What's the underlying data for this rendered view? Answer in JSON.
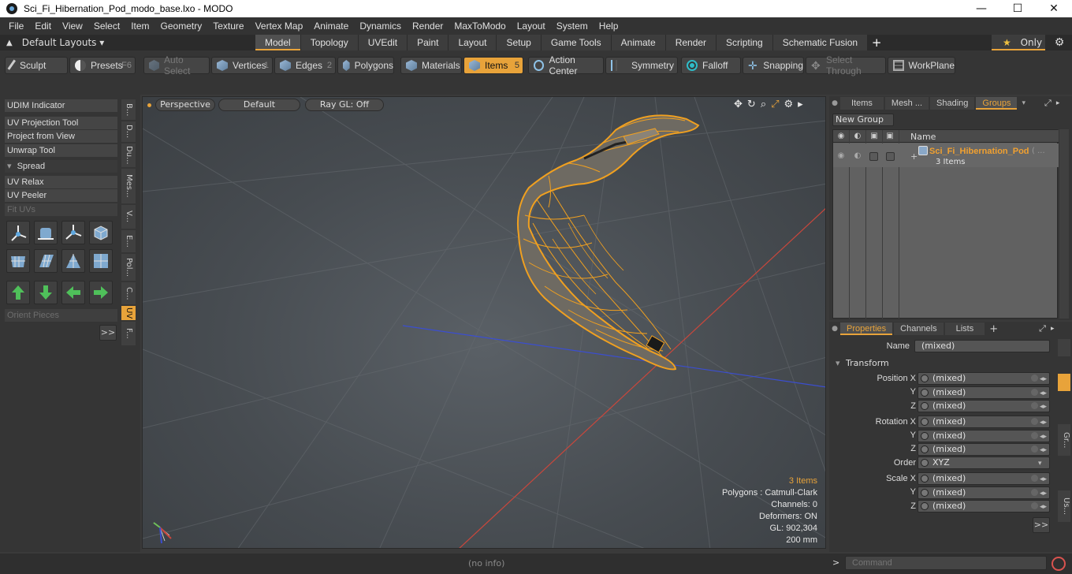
{
  "window": {
    "title": "Sci_Fi_Hibernation_Pod_modo_base.lxo - MODO",
    "minimize": "—",
    "maximize": "☐",
    "close": "✕"
  },
  "menu": [
    "File",
    "Edit",
    "View",
    "Select",
    "Item",
    "Geometry",
    "Texture",
    "Vertex Map",
    "Animate",
    "Dynamics",
    "Render",
    "MaxToModo",
    "Layout",
    "System",
    "Help"
  ],
  "layout_bar": {
    "layouts_label": "Default Layouts ▾",
    "tabs": [
      "Model",
      "Topology",
      "UVEdit",
      "Paint",
      "Layout",
      "Setup",
      "Game Tools",
      "Animate",
      "Render",
      "Scripting",
      "Schematic Fusion"
    ],
    "active_tab": "Model",
    "only_label": "Only",
    "add": "+"
  },
  "toolbar": {
    "sculpt": "Sculpt",
    "presets": "Presets",
    "presets_key": "F6",
    "auto_select": "Auto Select",
    "vertices": "Vertices",
    "vertices_key": "1",
    "edges": "Edges",
    "edges_key": "2",
    "polygons": "Polygons",
    "materials": "Materials",
    "items": "Items",
    "items_key": "5",
    "action_center": "Action Center",
    "symmetry": "Symmetry",
    "falloff": "Falloff",
    "snapping": "Snapping",
    "select_through": "Select Through",
    "workplane": "WorkPlane"
  },
  "left_panel": {
    "udim": "UDIM Indicator",
    "uv_projection": "UV Projection Tool",
    "project_from_view": "Project from View",
    "unwrap": "Unwrap Tool",
    "spread": "Spread",
    "uv_relax": "UV Relax",
    "uv_peeler": "UV Peeler",
    "fit_uvs": "Fit UVs",
    "orient_pieces": "Orient Pieces",
    "more": ">>",
    "vtabs": [
      "B...",
      "D...",
      "Du...",
      "Mes...",
      "V...",
      "E...",
      "Pol...",
      "C...",
      "UV",
      "F..."
    ]
  },
  "viewport": {
    "view": "Perspective",
    "style": "Default",
    "raygl": "Ray GL: Off",
    "info": {
      "items": "3 Items",
      "polygons": "Polygons : Catmull-Clark",
      "channels": "Channels: 0",
      "deformers": "Deformers: ON",
      "gl": "GL: 902,304",
      "scale": "200 mm"
    }
  },
  "groups_panel": {
    "tabs": [
      "Items",
      "Mesh ...",
      "Shading",
      "Groups"
    ],
    "active_tab": "Groups",
    "new_group": "New Group",
    "col_name": "Name",
    "group_name": "Sci_Fi_Hibernation_Pod",
    "group_count": "3 Items",
    "group_more": "( ..."
  },
  "properties_panel": {
    "tabs": [
      "Properties",
      "Channels",
      "Lists"
    ],
    "active_tab": "Properties",
    "name_label": "Name",
    "name_value": "(mixed)",
    "transform_label": "Transform",
    "position_x": "Position X",
    "rotation_x": "Rotation X",
    "scale_x": "Scale X",
    "y": "Y",
    "z": "Z",
    "order_label": "Order",
    "order_value": "XYZ",
    "mixed": "(mixed)",
    "more": ">>",
    "side_tabs": [
      "Gr...",
      "Us..."
    ]
  },
  "status_bar": {
    "info": "(no info)",
    "command_placeholder": "Command",
    "prompt": ">"
  },
  "colors": {
    "accent": "#e8a33a",
    "wire": "#f0a020",
    "background": "#3a3a3a"
  }
}
